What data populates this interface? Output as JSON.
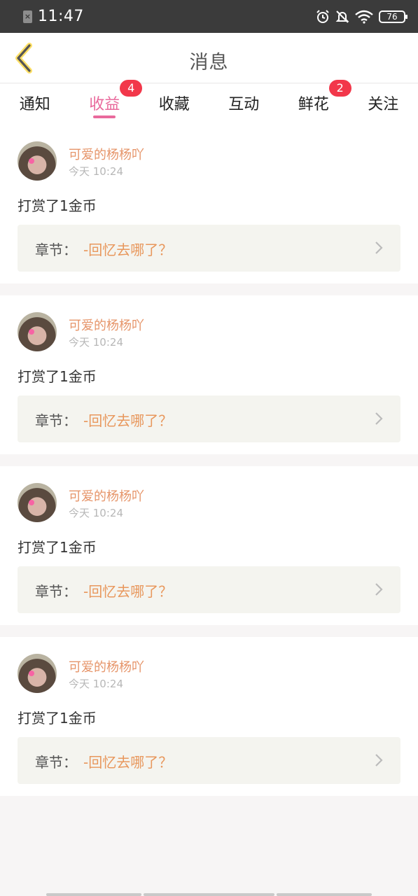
{
  "status_bar": {
    "time": "11:47",
    "battery": "76",
    "sim_symbol": "×"
  },
  "header": {
    "title": "消息",
    "back_icon": "chevron-left-icon"
  },
  "tabs": [
    {
      "label": "通知",
      "badge": ""
    },
    {
      "label": "收益",
      "badge": "4"
    },
    {
      "label": "收藏",
      "badge": ""
    },
    {
      "label": "互动",
      "badge": ""
    },
    {
      "label": "鲜花",
      "badge": "2"
    },
    {
      "label": "关注",
      "badge": ""
    }
  ],
  "active_tab": "收益",
  "accent_color": "#e96a9c",
  "badge_color": "#f2374a",
  "messages": [
    {
      "username": "可爱的杨杨吖",
      "time": "今天 10:24",
      "action": "打赏了1金币",
      "chapter_label": "章节：",
      "chapter_title": "-回忆去哪了？"
    },
    {
      "username": "可爱的杨杨吖",
      "time": "今天 10:24",
      "action": "打赏了1金币",
      "chapter_label": "章节：",
      "chapter_title": "-回忆去哪了？"
    },
    {
      "username": "可爱的杨杨吖",
      "time": "今天 10:24",
      "action": "打赏了1金币",
      "chapter_label": "章节：",
      "chapter_title": "-回忆去哪了？"
    },
    {
      "username": "可爱的杨杨吖",
      "time": "今天 10:24",
      "action": "打赏了1金币",
      "chapter_label": "章节：",
      "chapter_title": "-回忆去哪了？"
    }
  ]
}
